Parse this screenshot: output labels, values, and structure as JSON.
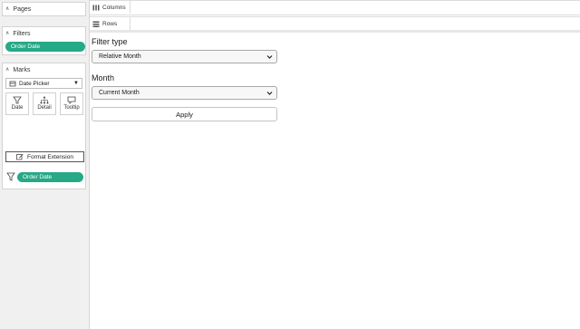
{
  "left_pane": {
    "pages_title": "Pages",
    "filters_title": "Filters",
    "filters_pill": "Order Date",
    "marks_title": "Marks",
    "mark_type": "Date Picker",
    "mark_buttons": [
      "Date",
      "Detail",
      "Tooltip"
    ],
    "format_extension_label": "Format Extension",
    "marks_pill": "Order Date"
  },
  "shelves": {
    "columns_label": "Columns",
    "rows_label": "Rows"
  },
  "viz": {
    "filter_type_label": "Filter type",
    "filter_type_value": "Relative Month",
    "month_label": "Month",
    "month_value": "Current Month",
    "apply_label": "Apply"
  },
  "colors": {
    "pill_green": "#26a987",
    "pane_bg": "#f0f0f0"
  },
  "icons": {
    "collapse": "caret-up-icon",
    "columns": "columns-icon",
    "rows": "rows-icon",
    "mark_type": "date-picker-icon",
    "date": "filter-funnel-icon",
    "detail": "detail-tree-icon",
    "tooltip": "speech-bubble-icon",
    "format": "edit-pencil-icon",
    "filter": "funnel-icon"
  }
}
